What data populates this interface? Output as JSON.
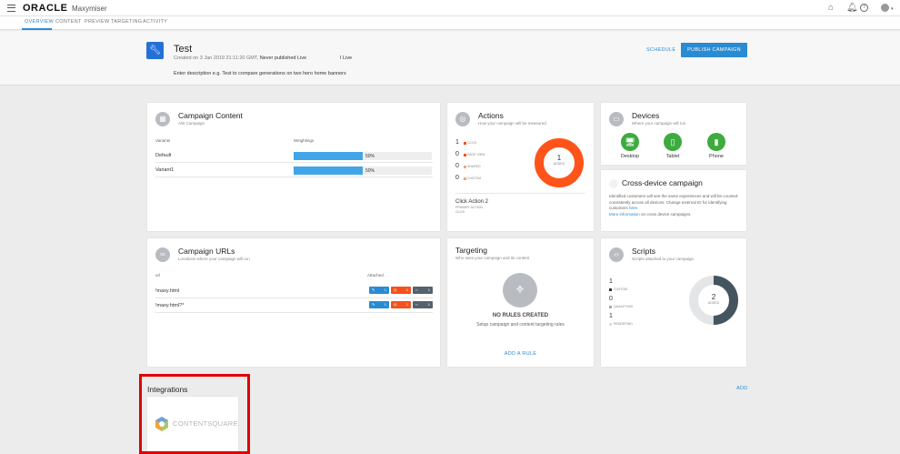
{
  "brand": {
    "company": "ORACLE",
    "product": "Maxymiser"
  },
  "top_icons": [
    "home-icon",
    "bell-icon",
    "help-icon",
    "avatar"
  ],
  "tabs": [
    "OVERVIEW",
    "CONTENT",
    "PREVIEW",
    "TARGETING",
    "ACTIVITY"
  ],
  "campaign": {
    "title": "Test",
    "created": "Created on 3 Jan 2019 21:11:20 GMT,",
    "status": "Never published Live",
    "live": "I Live",
    "description": "Enter description e.g. Test to compare generations on two hero home banners",
    "schedule_label": "SCHEDULE",
    "publish_label": "PUBLISH CAMPAIGN"
  },
  "content_card": {
    "title": "Campaign Content",
    "subtitle": "A/B Campaign",
    "col_variants": "Variants",
    "col_weightings": "Weightings",
    "rows": [
      {
        "name": "Default",
        "weight": "50%",
        "fraction": 0.5
      },
      {
        "name": "Variant1",
        "weight": "50%",
        "fraction": 0.5
      }
    ]
  },
  "actions_card": {
    "title": "Actions",
    "subtitle": "How your campaign will be measured",
    "items": [
      {
        "count": "1",
        "label": "CLICK",
        "color": "#f4511e"
      },
      {
        "count": "0",
        "label": "PAGE VIEW",
        "color": "#f4511e"
      },
      {
        "count": "0",
        "label": "SHARED",
        "color": "#f4a57a"
      },
      {
        "count": "0",
        "label": "CUSTOM",
        "color": "#f4a57a"
      }
    ],
    "donut_value": "1",
    "donut_label": "ADDED",
    "primary_name": "Click Action 2",
    "primary_label": "PRIMARY ACTION",
    "primary_type": "CLICK",
    "accent": "#ff5419"
  },
  "devices_card": {
    "title": "Devices",
    "subtitle": "Where your campaign will run",
    "devices": [
      "Desktop",
      "Tablet",
      "Phone"
    ],
    "color": "#3dab3d"
  },
  "crossdevice_card": {
    "title": "Cross-device campaign",
    "text": "Identified customers will see the same experiences and will be counted consistently across all devices. Change external ID for identifying customers",
    "here_link": "here.",
    "more_link": "More information",
    "more_tail": "on cross device campaigns."
  },
  "urls_card": {
    "title": "Campaign URLs",
    "subtitle": "Locations where your campaign will run",
    "col_url": "url",
    "col_attached": "Attached",
    "rows": [
      {
        "url": "!maxy.html",
        "a": "1",
        "b": "1",
        "c": "1"
      },
      {
        "url": "!maxy.html?*",
        "a": "1",
        "b": "1",
        "c": "1"
      }
    ]
  },
  "targeting_card": {
    "title": "Targeting",
    "subtitle": "Who sees your campaign and its content",
    "empty_title": "NO RULES CREATED",
    "empty_text": "Setup campaign and content targeting rules",
    "add_rule": "ADD A RULE"
  },
  "scripts_card": {
    "title": "Scripts",
    "subtitle": "Scripts attached to your campaign",
    "items": [
      {
        "count": "1",
        "label": "CUSTOM"
      },
      {
        "count": "0",
        "label": "QUALIFYING"
      },
      {
        "count": "1",
        "label": "RENDERING"
      }
    ],
    "donut_value": "2",
    "donut_label": "ADDED"
  },
  "integrations": {
    "title": "Integrations",
    "add_label": "ADD",
    "logo_text": "CONTENTSQUARE"
  }
}
